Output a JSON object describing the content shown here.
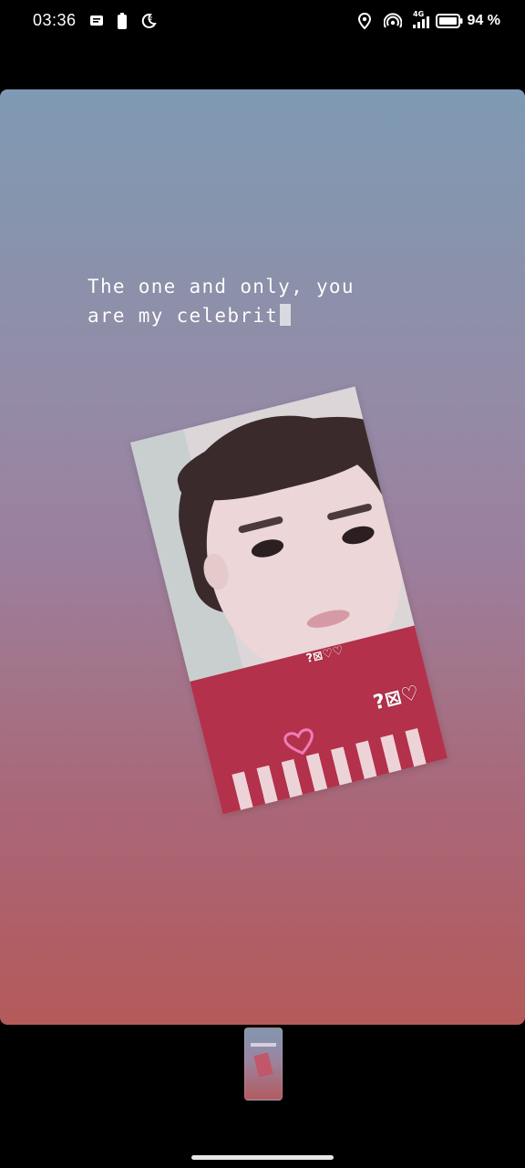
{
  "status_bar": {
    "time": "03:36",
    "battery_percent": "94 %",
    "network": "4G",
    "icons": [
      "message-icon",
      "battery-small-icon",
      "moon-icon",
      "location-icon",
      "hotspot-icon",
      "signal-icon",
      "battery-icon"
    ]
  },
  "story": {
    "text_line1": "The one and only, you",
    "text_line2": "are my celebrit",
    "sticker_small": "?⊠♡♡",
    "sticker_big": "?⊠♡",
    "colors": {
      "gradient_top": "#7f9ab4",
      "gradient_bottom": "#b45a5a",
      "shirt": "#b3314a"
    }
  }
}
